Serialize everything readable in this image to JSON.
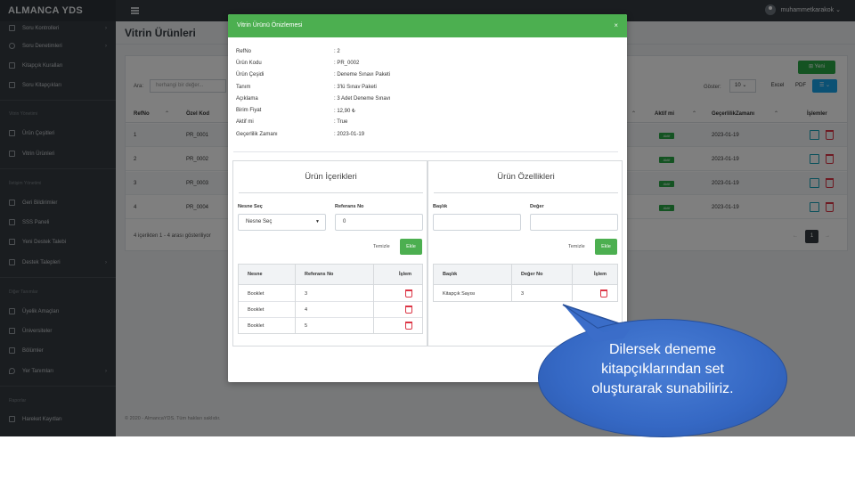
{
  "app": {
    "brand": "ALMANCA YDS",
    "user": "muhammetkarakok ⌄"
  },
  "sidebar": {
    "items": [
      {
        "label": "Soru Kontrolleri",
        "arrow": "›"
      },
      {
        "label": "Soru Denetimleri",
        "arrow": "›"
      },
      {
        "label": "Kitapçık Kuralları",
        "arrow": ""
      },
      {
        "label": "Soru Kitapçıkları",
        "arrow": ""
      },
      {
        "label": "Ürün Çeşitleri",
        "arrow": ""
      },
      {
        "label": "Vitrin Ürünleri",
        "arrow": ""
      },
      {
        "label": "Geri Bildirimler",
        "arrow": ""
      },
      {
        "label": "SSS Paneli",
        "arrow": ""
      },
      {
        "label": "Yeni Destek Talebi",
        "arrow": ""
      },
      {
        "label": "Destek Talepleri",
        "arrow": "›"
      },
      {
        "label": "Üyelik Amaçları",
        "arrow": ""
      },
      {
        "label": "Üniversiteler",
        "arrow": ""
      },
      {
        "label": "Bölümler",
        "arrow": ""
      },
      {
        "label": "Yer Tanımları",
        "arrow": "›"
      },
      {
        "label": "Hareket Kayıtları",
        "arrow": ""
      }
    ],
    "headers": [
      "Vitrin Yönetimi",
      "İletişim Yönetimi",
      "Diğer Tanımlar",
      "Raporlar"
    ]
  },
  "page": {
    "title": "Vitrin Ürünleri",
    "new_button": "⊞ Yeni",
    "search_label": "Ara:",
    "search_placeholder": "herhangi bir değer...",
    "show_label": "Göster:",
    "show_value": "10 ⌄",
    "excel": "Excel",
    "pdf": "PDF",
    "columns_btn": "☰ ⌄",
    "columns": [
      "RefNo",
      "Özel Kod",
      "Aktif mi",
      "GeçerlilikZamanı",
      "İşlemler"
    ],
    "sort_icons": [
      "⌃",
      "⌃",
      "⌃",
      "⌃"
    ],
    "rows": [
      {
        "refno": "1",
        "kod": "PR_0001",
        "aktif": "Aktif",
        "tarih": "2023-01-19"
      },
      {
        "refno": "2",
        "kod": "PR_0002",
        "aktif": "Aktif",
        "tarih": "2023-01-19"
      },
      {
        "refno": "3",
        "kod": "PR_0003",
        "aktif": "Aktif",
        "tarih": "2023-01-19"
      },
      {
        "refno": "4",
        "kod": "PR_0004",
        "aktif": "Aktif",
        "tarih": "2023-01-19"
      }
    ],
    "info": "4 içerikten 1 - 4 arası gösteriliyor",
    "pager": {
      "prev": "←",
      "page": "1",
      "next": "→"
    },
    "footer": "© 2020 - AlmancaYDS. Tüm hakları saklıdır."
  },
  "modal": {
    "title": "Vitrin Ürünü Önizlemesi",
    "close": "×",
    "fields": [
      {
        "key": "RefNo",
        "value": ": 2"
      },
      {
        "key": "Ürün Kodu",
        "value": ": PR_0002"
      },
      {
        "key": "Ürün Çeşidi",
        "value": ": Deneme Sınavı Paketi"
      },
      {
        "key": "Tanım",
        "value": ": 3'lü Sınav Paketi"
      },
      {
        "key": "Açıklama",
        "value": ": 3 Adet Deneme Sınavı"
      },
      {
        "key": "Birim Fiyat",
        "value": ": 12,90 ₺"
      },
      {
        "key": "Aktif mi",
        "value": ": True"
      },
      {
        "key": "Geçerlilik Zamanı",
        "value": ": 2023-01-19"
      }
    ],
    "contents": {
      "title": "Ürün İçerikleri",
      "label_select": "Nesne Seç",
      "label_ref": "Referans No",
      "select_value": "Nesne Seç",
      "select_caret": "▼",
      "ref_value": "0",
      "clear": "Temizle",
      "add": "Ekle",
      "columns": [
        "Nesne",
        "Referans No",
        "İşlem"
      ],
      "rows": [
        {
          "nesne": "Booklet",
          "ref": "3"
        },
        {
          "nesne": "Booklet",
          "ref": "4"
        },
        {
          "nesne": "Booklet",
          "ref": "5"
        }
      ]
    },
    "features": {
      "title": "Ürün Özellikleri",
      "label_title": "Başlık",
      "label_value": "Değer",
      "clear": "Temizle",
      "add": "Ekle",
      "columns": [
        "Başlık",
        "Değer No",
        "İşlem"
      ],
      "rows": [
        {
          "baslik": "Kitapçık Sayısı",
          "deger": "3"
        }
      ]
    }
  },
  "callout": {
    "lines": [
      "Dilersek deneme",
      "kitapçıklarından set",
      "oluşturarak sunabiliriz."
    ]
  },
  "colors": {
    "sidebar": "#343a40",
    "modal_header": "#4caf50",
    "success": "#28a745",
    "danger": "#dc3545",
    "bubble": "#3568c4"
  }
}
